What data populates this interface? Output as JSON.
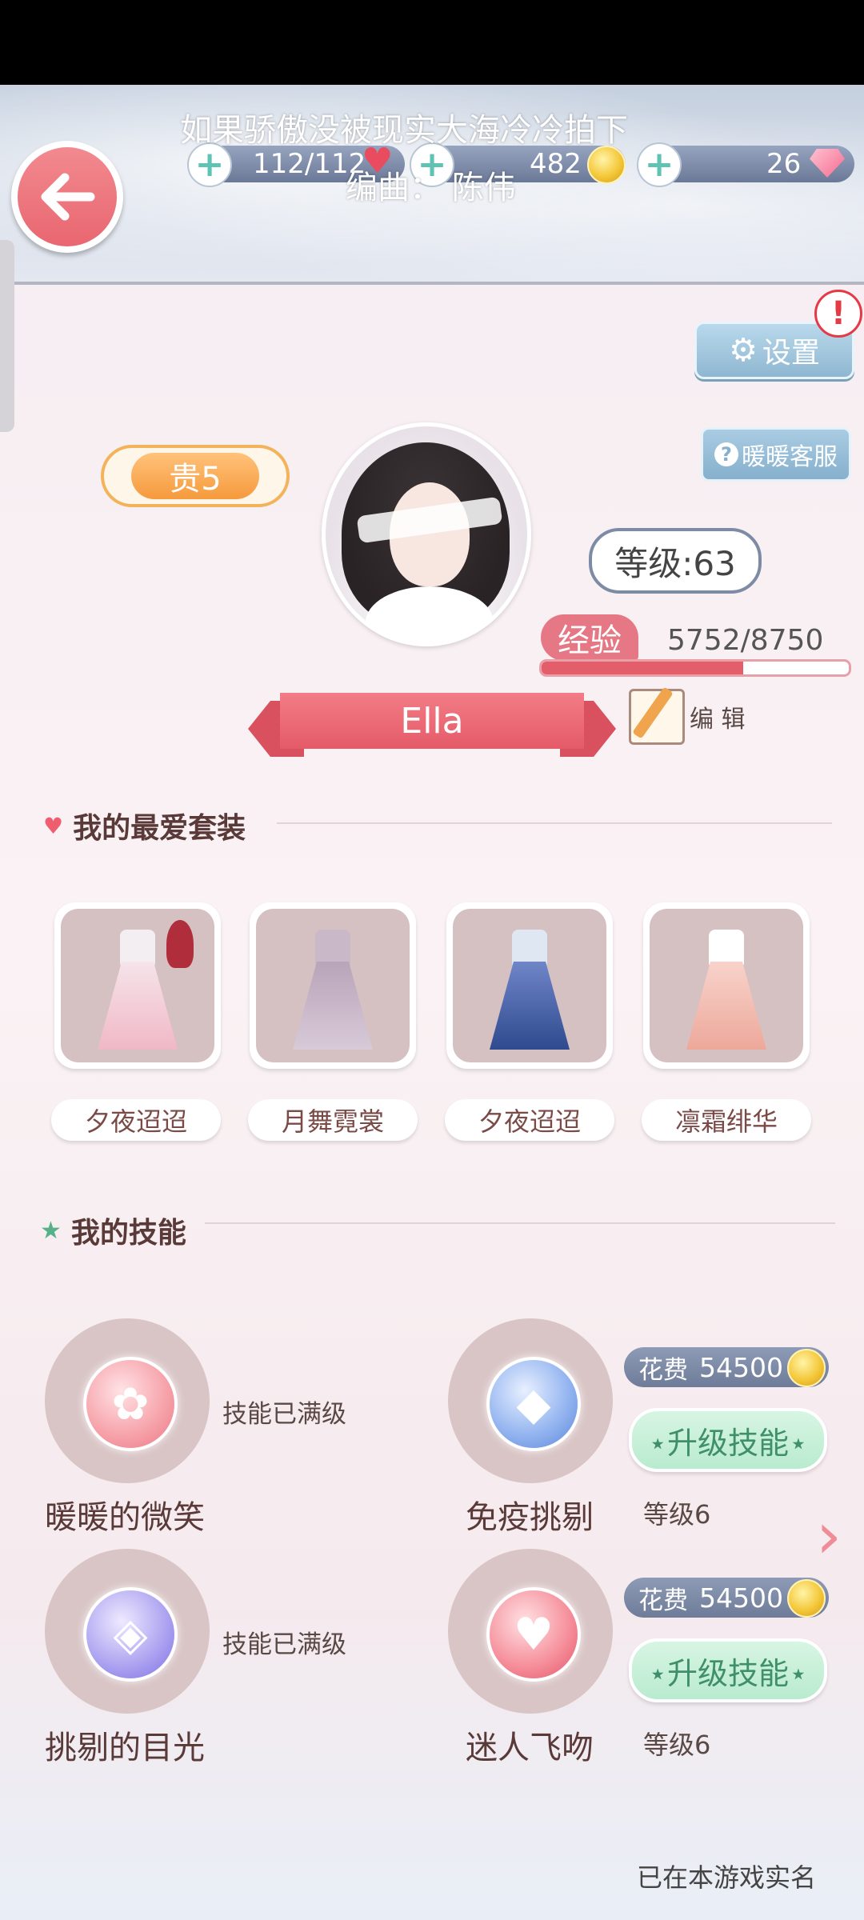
{
  "lyrics": {
    "line1": "如果骄傲没被现实大海冷冷拍下",
    "line2": "编曲：  陈伟"
  },
  "resources": {
    "stamina": "112/112",
    "gold": "482",
    "diamond": "26"
  },
  "icons": {
    "back": "back-arrow-icon",
    "settings": "gear-icon",
    "alert": "exclamation-icon",
    "help": "question-icon",
    "edit": "pencil-notebook-icon",
    "favorite": "heart-icon",
    "skills": "star-icon",
    "next": "chevron-right-icon"
  },
  "header": {
    "settings_label": "设置",
    "alert_mark": "!",
    "service_label": "暖暖客服",
    "help_mark": "?"
  },
  "profile": {
    "vip": "贵5",
    "level": "等级:63",
    "exp_label": "经验",
    "exp_value": "5752/8750",
    "exp_fraction": 0.657,
    "name": "Ella",
    "edit_label": "编 辑"
  },
  "favorites": {
    "title": "我的最爱套装",
    "items": [
      {
        "name": "夕夜迢迢"
      },
      {
        "name": "月舞霓裳"
      },
      {
        "name": "夕夜迢迢"
      },
      {
        "name": "凛霜绯华"
      }
    ]
  },
  "skills": {
    "title": "我的技能",
    "items": [
      {
        "name": "暖暖的微笑",
        "status": "技能已满级"
      },
      {
        "name": "免疫挑剔",
        "cost_label": "花费",
        "cost": "54500",
        "upgrade": "⋆升级技能⋆",
        "level": "等级6"
      },
      {
        "name": "挑剔的目光",
        "status": "技能已满级"
      },
      {
        "name": "迷人飞吻",
        "cost_label": "花费",
        "cost": "54500",
        "upgrade": "⋆升级技能⋆",
        "level": "等级6"
      }
    ]
  },
  "footer": {
    "realname": "已在本游戏实名"
  },
  "colors": {
    "accent": "#e45b68",
    "skill_green": "#3f8f6a",
    "resource_bar": "#7c89a7"
  }
}
